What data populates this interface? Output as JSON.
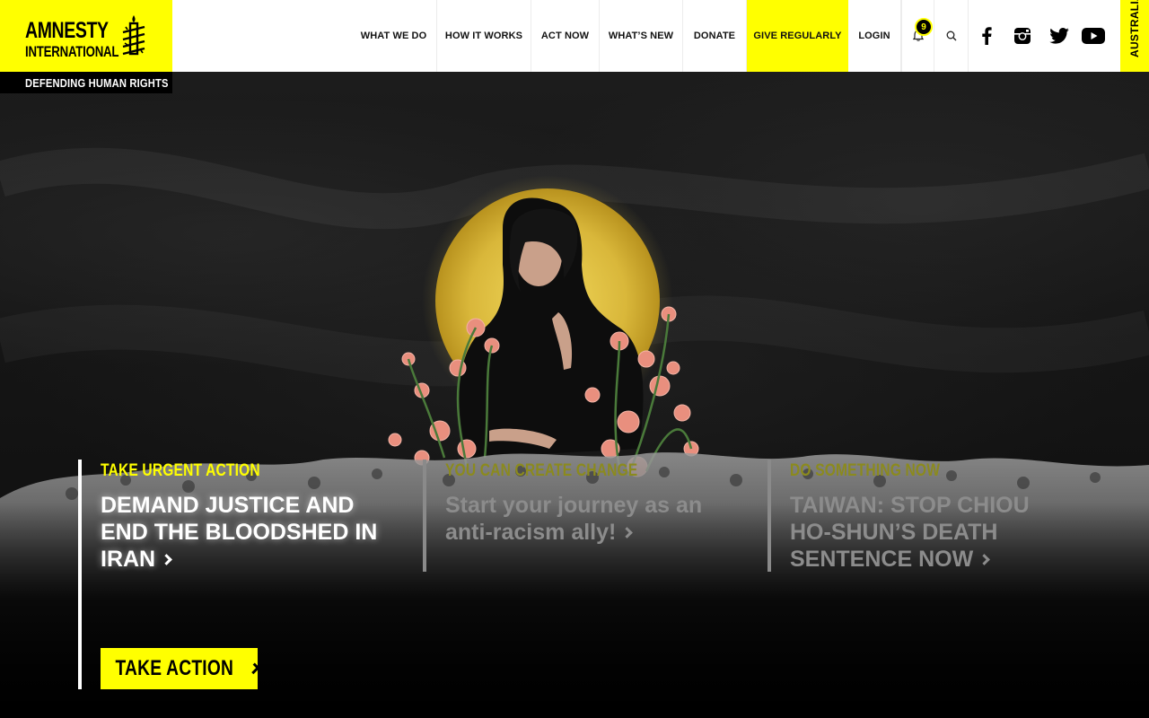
{
  "brand": {
    "logo_line1": "AMNESTY",
    "logo_line2": "INTERNATIONAL",
    "tagline": "DEFENDING HUMAN RIGHTS",
    "accent_color": "#ffff00",
    "logo_icon": "candle-barbed-wire-icon"
  },
  "nav": {
    "items": [
      {
        "label": "WHAT WE DO"
      },
      {
        "label": "HOW IT WORKS"
      },
      {
        "label": "ACT NOW"
      },
      {
        "label": "WHAT’S NEW"
      },
      {
        "label": "DONATE"
      },
      {
        "label": "GIVE REGULARLY"
      },
      {
        "label": "LOGIN"
      }
    ],
    "notification_count": "9",
    "notification_icon": "bell-icon",
    "search_icon": "search-icon",
    "social": [
      "facebook-icon",
      "instagram-icon",
      "twitter-icon",
      "youtube-icon"
    ],
    "country": "AUSTRALIA"
  },
  "hero": {
    "features": [
      {
        "kicker": "TAKE URGENT ACTION",
        "headline": "DEMAND JUSTICE AND END THE BLOODSHED IN IRAN"
      },
      {
        "kicker": "YOU CAN CREATE CHANGE",
        "headline": "Start your journey as an anti-racism ally!"
      },
      {
        "kicker": "DO SOMETHING NOW",
        "headline": "TAIWAN: STOP CHIOU HO-SHUN’S DEATH SENTENCE NOW"
      }
    ],
    "cta_label": "TAKE ACTION"
  }
}
